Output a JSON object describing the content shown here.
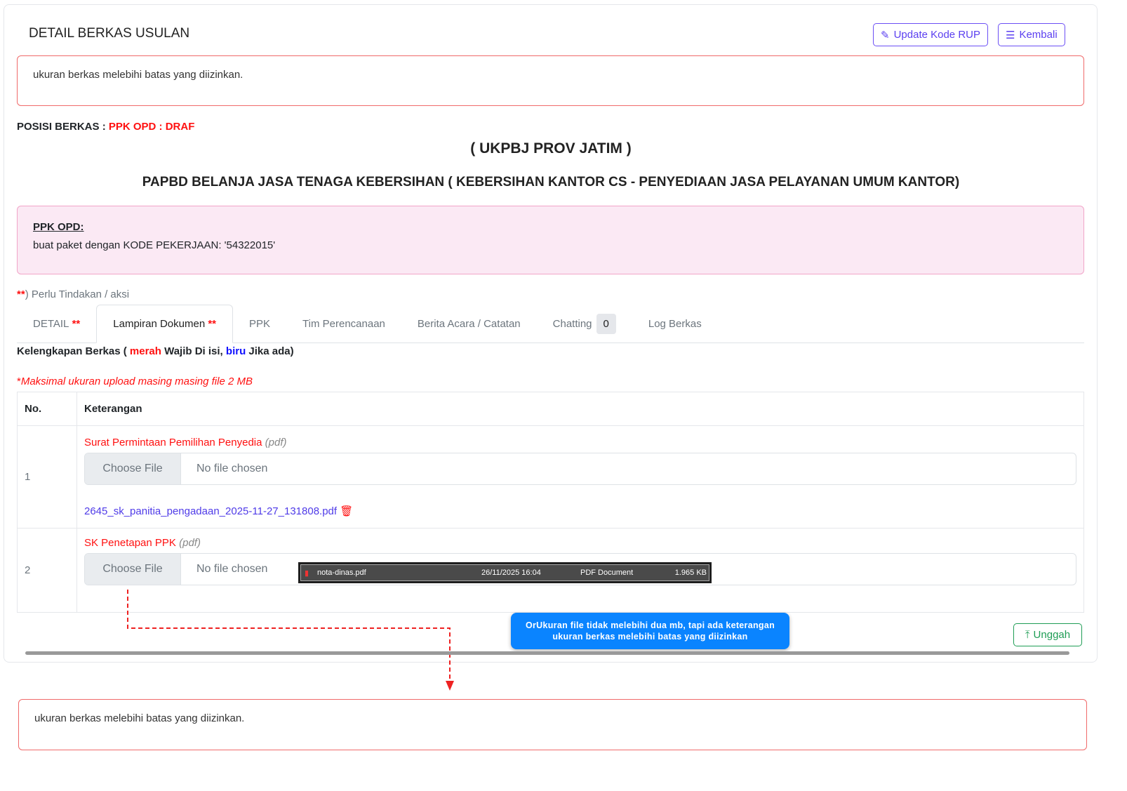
{
  "header": {
    "title": "DETAIL BERKAS USULAN",
    "update_label": "Update Kode RUP",
    "back_label": "Kembali"
  },
  "alert_top": "ukuran berkas melebihi batas yang diizinkan.",
  "position": {
    "label": "POSISI BERKAS : ",
    "value": "PPK OPD : DRAF"
  },
  "org": "( UKPBJ PROV JATIM )",
  "package": "PAPBD BELANJA JASA TENAGA KEBERSIHAN ( KEBERSIHAN KANTOR CS - PENYEDIAAN JASA PELAYANAN UMUM KANTOR)",
  "note": {
    "heading": "PPK OPD:",
    "text": "buat paket dengan KODE PEKERJAAN: '54322015'"
  },
  "action_note": {
    "stars": "**",
    "text": ") Perlu Tindakan / aksi"
  },
  "tabs": [
    {
      "label": "DETAIL",
      "stars": "**"
    },
    {
      "label": "Lampiran Dokumen",
      "stars": "**"
    },
    {
      "label": "PPK"
    },
    {
      "label": "Tim Perencanaan"
    },
    {
      "label": "Berita Acara / Catatan"
    },
    {
      "label": "Chatting",
      "badge": "0"
    },
    {
      "label": "Log Berkas"
    }
  ],
  "completeness": {
    "a": "Kelengkapan Berkas ( ",
    "red": "merah",
    "b": " Wajib Di isi, ",
    "blue": "biru",
    "c": " Jika ada)"
  },
  "max_note": {
    "star": "*",
    "text": "Maksimal ukuran upload masing masing file 2 MB"
  },
  "table": {
    "headers": [
      "No.",
      "Keterangan"
    ],
    "rows": [
      {
        "no": "1",
        "title": "Surat Permintaan Pemilihan Penyedia",
        "type": "(pdf)",
        "choose": "Choose File",
        "nofile": "No file chosen",
        "uploaded": "2645_sk_panitia_pengadaan_2025-11-27_131808.pdf"
      },
      {
        "no": "2",
        "title": "SK Penetapan PPK",
        "type": "(pdf)",
        "choose": "Choose File",
        "nofile": "No file chosen"
      }
    ]
  },
  "explorer": {
    "name": "nota-dinas.pdf",
    "date": "26/11/2025 16:04",
    "type": "PDF Document",
    "size": "1.965 KB"
  },
  "tooltip": {
    "line1": "OrUkuran file tidak melebihi dua mb, tapi ada keterangan",
    "line2": "ukuran berkas melebihi batas yang diizinkan"
  },
  "upload_label": "Unggah",
  "alert_bottom": "ukuran berkas melebihi batas yang diizinkan."
}
